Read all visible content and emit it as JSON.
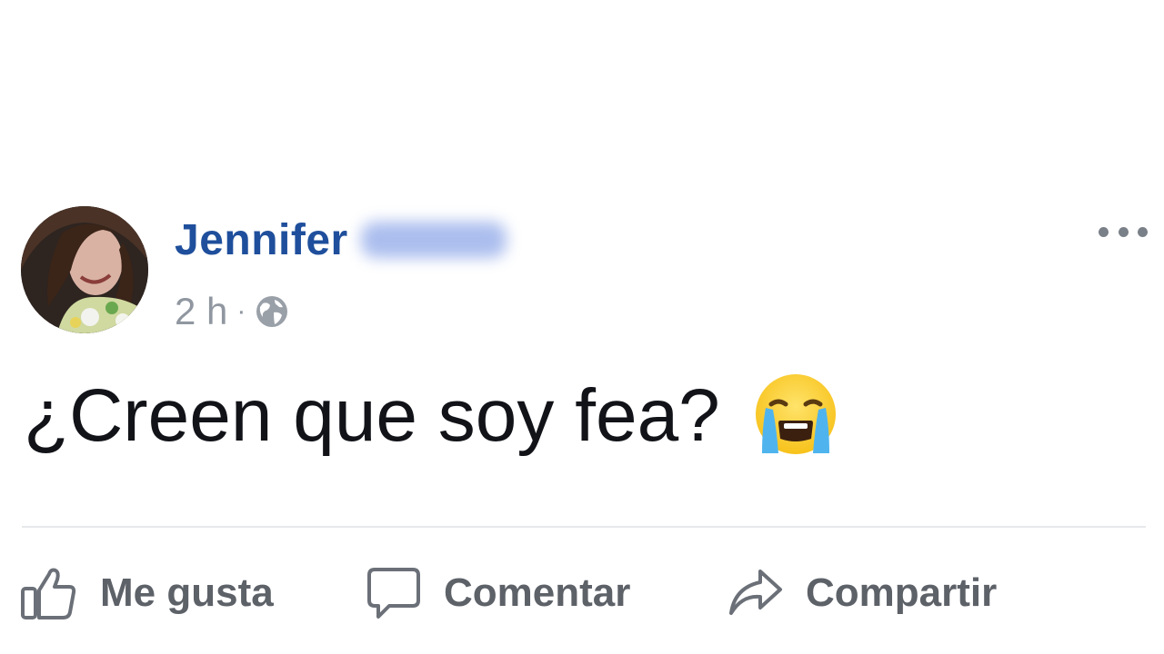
{
  "post": {
    "author_first_name": "Jennifer",
    "author_surname_redacted": true,
    "timestamp": "2 h",
    "separator": "·",
    "privacy_icon": "globe-icon",
    "text": "¿Creen que soy fea?",
    "emoji": "loudly-crying-face-emoji"
  },
  "actions": {
    "like_label": "Me gusta",
    "comment_label": "Comentar",
    "share_label": "Compartir"
  },
  "colors": {
    "author_name": "#1f4f9c",
    "meta_text": "#9097a0",
    "action_text": "#5d6168",
    "post_text": "#111318",
    "divider": "#e6e8eb"
  }
}
